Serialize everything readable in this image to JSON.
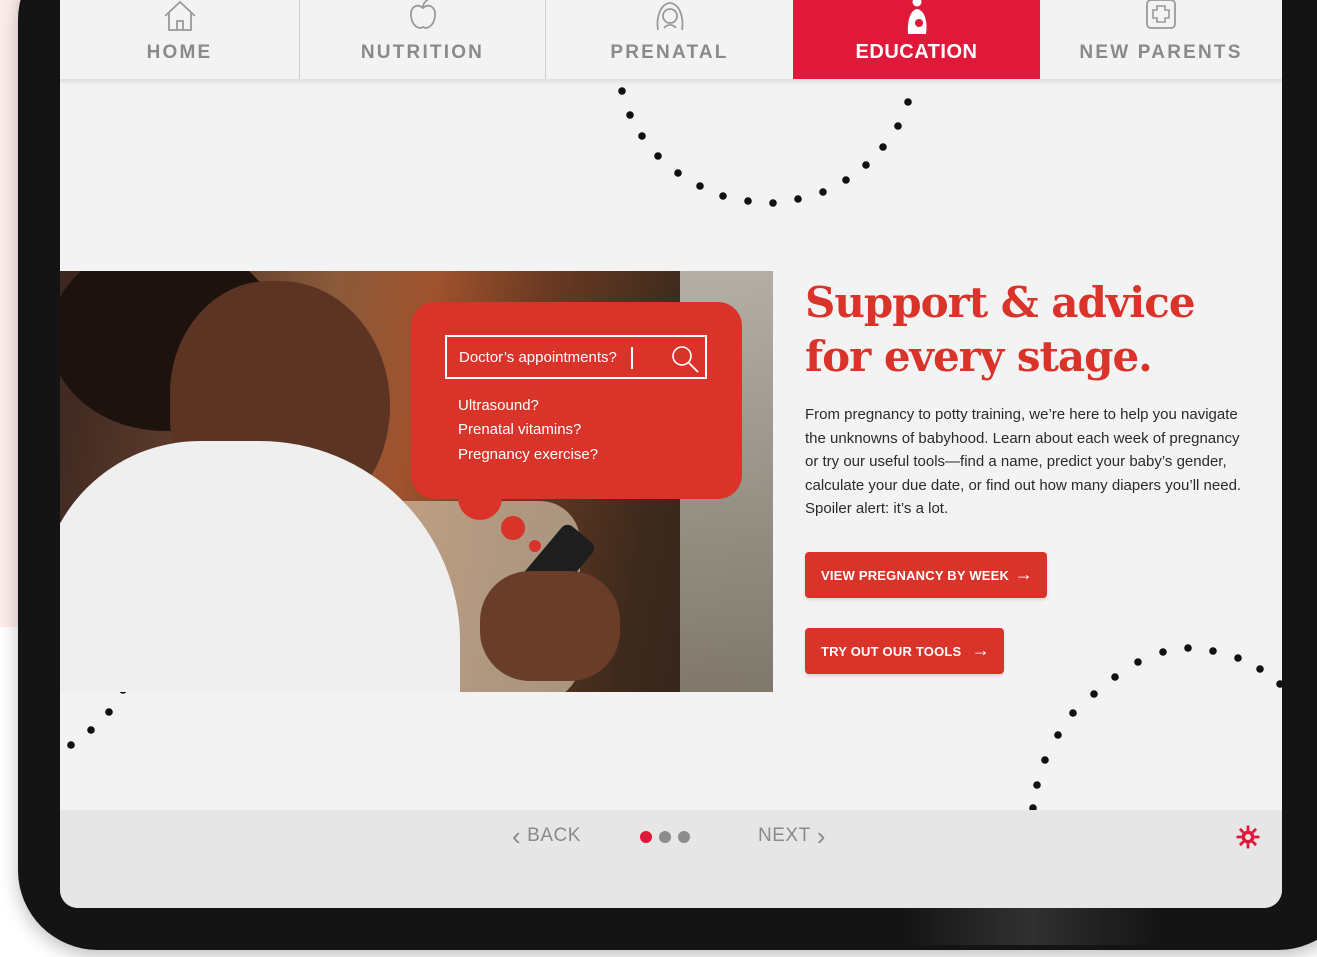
{
  "nav": {
    "items": [
      {
        "label": "HOME",
        "icon": "home-icon",
        "active": false
      },
      {
        "label": "NUTRITION",
        "icon": "apple-icon",
        "active": false
      },
      {
        "label": "PRENATAL",
        "icon": "pregnant-woman-icon",
        "active": false
      },
      {
        "label": "EDUCATION",
        "icon": "mother-baby-icon",
        "active": true
      },
      {
        "label": "NEW PARENTS",
        "icon": "medical-cross-icon",
        "active": false
      }
    ]
  },
  "search": {
    "query": "Doctor’s appointments?",
    "suggestions": [
      "Ultrasound?",
      "Prenatal vitamins?",
      "Pregnancy exercise?"
    ]
  },
  "hero": {
    "headline_line1": "Support & advice",
    "headline_line2": "for every stage.",
    "paragraph": "From pregnancy to potty training, we’re here to help you navigate the unknowns of babyhood. Learn about each week of pregnancy or try our useful tools—find a name, predict your baby’s gender, calculate your due date, or find out how many diapers you’ll need. Spoiler alert: it’s a lot."
  },
  "buttons": {
    "pregnancy_week": "VIEW PREGNANCY BY WEEK",
    "tools": "TRY OUT OUR TOOLS",
    "arrow": "→"
  },
  "footer": {
    "back_label": "BACK",
    "next_label": "NEXT",
    "chevron_left": "‹",
    "chevron_right": "›",
    "pages": 3,
    "current_page": 1
  },
  "colors": {
    "accent": "#e0193a",
    "brand_red": "#d9332a",
    "nav_text": "#8a8a8a",
    "screen_bg": "#f3f3f3"
  }
}
